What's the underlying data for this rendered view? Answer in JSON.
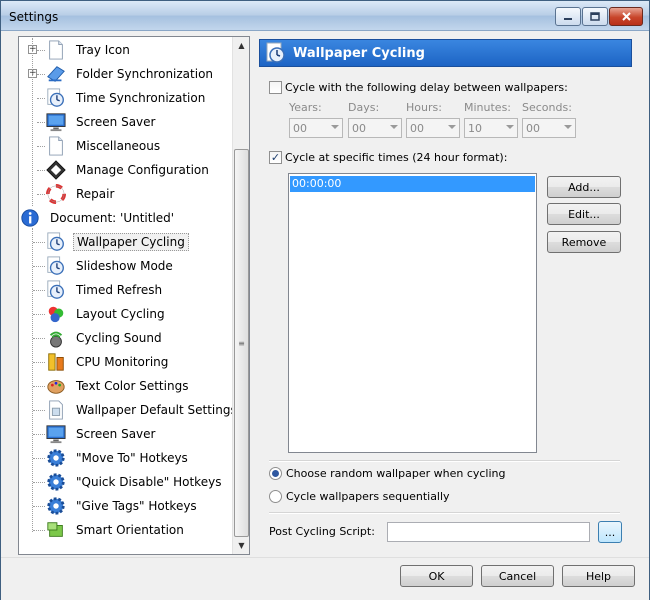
{
  "window": {
    "title": "Settings"
  },
  "tree": {
    "items": [
      {
        "label": "Tray Icon",
        "icon": "tray-icon-doc",
        "expander": "+"
      },
      {
        "label": "Folder Synchronization",
        "icon": "folder-sync-icon",
        "expander": "+"
      },
      {
        "label": "Time Synchronization",
        "icon": "clock-icon"
      },
      {
        "label": "Screen Saver",
        "icon": "monitor-icon"
      },
      {
        "label": "Miscellaneous",
        "icon": "document-icon"
      },
      {
        "label": "Manage Configuration",
        "icon": "config-icon"
      },
      {
        "label": "Repair",
        "icon": "lifebuoy-icon"
      },
      {
        "label": "Document: 'Untitled'",
        "icon": "info-icon"
      },
      {
        "label": "Wallpaper Cycling",
        "icon": "clock-icon",
        "selected": true
      },
      {
        "label": "Slideshow Mode",
        "icon": "clock-icon"
      },
      {
        "label": "Timed Refresh",
        "icon": "clock-icon"
      },
      {
        "label": "Layout Cycling",
        "icon": "layout-icon"
      },
      {
        "label": "Cycling Sound",
        "icon": "sound-icon"
      },
      {
        "label": "CPU Monitoring",
        "icon": "cpu-icon"
      },
      {
        "label": "Text Color Settings",
        "icon": "palette-icon"
      },
      {
        "label": "Wallpaper Default Settings",
        "icon": "wallpaper-doc-icon"
      },
      {
        "label": "Screen Saver",
        "icon": "monitor-icon"
      },
      {
        "label": "\"Move To\" Hotkeys",
        "icon": "gear-icon"
      },
      {
        "label": "\"Quick Disable\" Hotkeys",
        "icon": "gear-icon"
      },
      {
        "label": "\"Give Tags\" Hotkeys",
        "icon": "gear-icon"
      },
      {
        "label": "Smart Orientation",
        "icon": "orientation-icon"
      }
    ]
  },
  "panel": {
    "title": "Wallpaper Cycling",
    "delay_checkbox_label": "Cycle with the following delay between wallpapers:",
    "delay_checked": false,
    "delay_fields": [
      {
        "label": "Years:",
        "value": "00"
      },
      {
        "label": "Days:",
        "value": "00"
      },
      {
        "label": "Hours:",
        "value": "00"
      },
      {
        "label": "Minutes:",
        "value": "10"
      },
      {
        "label": "Seconds:",
        "value": "00"
      }
    ],
    "times_checkbox_label": "Cycle at specific times (24 hour format):",
    "times_checked": true,
    "times": [
      "00:00:00"
    ],
    "add_label": "Add...",
    "edit_label": "Edit...",
    "remove_label": "Remove",
    "random_label": "Choose random wallpaper when cycling",
    "sequential_label": "Cycle wallpapers sequentially",
    "selected_order": "random",
    "script_label": "Post Cycling Script:",
    "script_value": "",
    "browse_label": "..."
  },
  "footer": {
    "ok_label": "OK",
    "cancel_label": "Cancel",
    "help_label": "Help"
  }
}
